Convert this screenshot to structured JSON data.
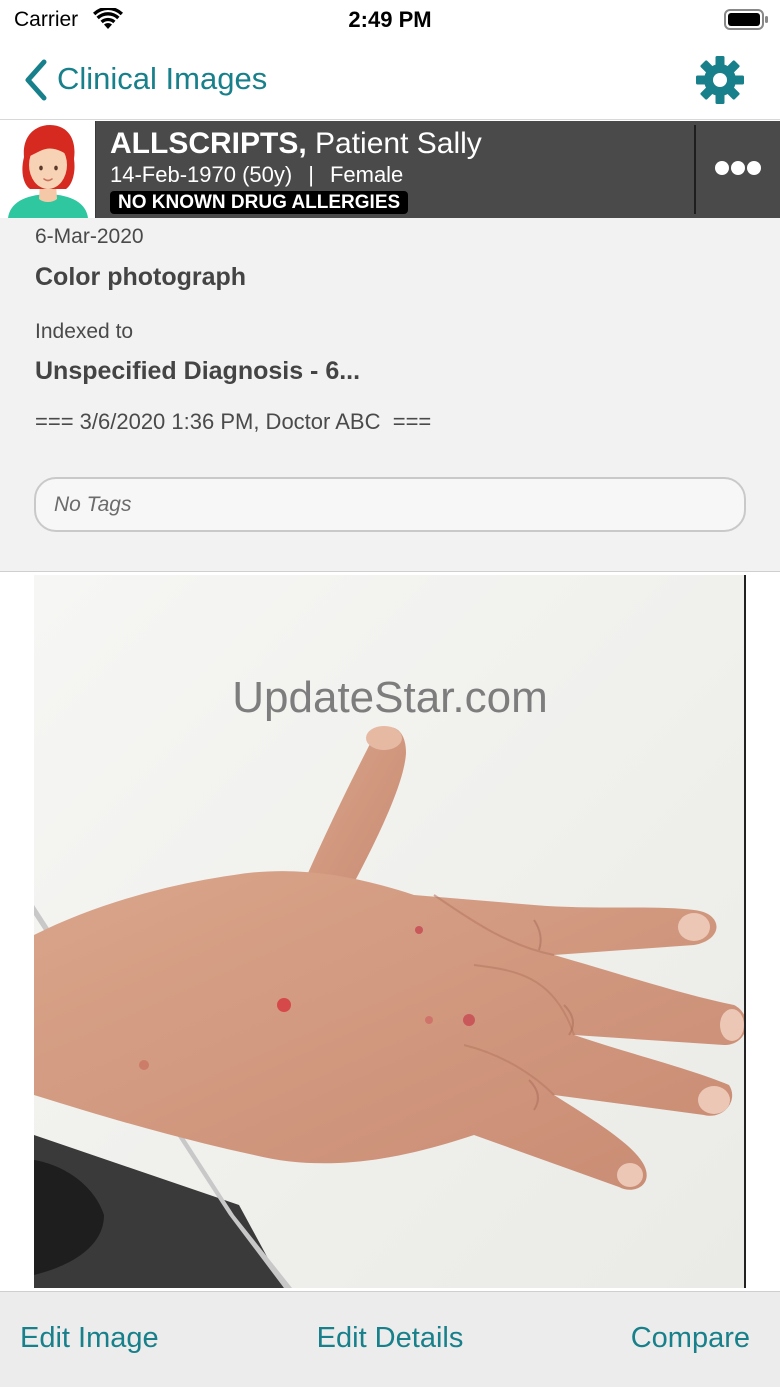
{
  "status_bar": {
    "carrier": "Carrier",
    "time": "2:49 PM"
  },
  "nav": {
    "back_label": "Clinical Images",
    "settings_icon": "gear-icon"
  },
  "patient": {
    "last_name": "ALLSCRIPTS,",
    "first_name": "Patient Sally",
    "dob": "14-Feb-1970 (50y)",
    "separator": "|",
    "gender": "Female",
    "allergy_banner": "NO KNOWN DRUG ALLERGIES"
  },
  "details": {
    "date": "6-Mar-2020",
    "type": "Color photograph",
    "indexed_label": "Indexed to",
    "diagnosis": "Unspecified Diagnosis - 6...",
    "note": "=== 3/6/2020 1:36 PM, Doctor ABC  ===",
    "tags_placeholder": "No Tags"
  },
  "image": {
    "watermark": "UpdateStar.com",
    "subject": "photo of a hand with red spots"
  },
  "toolbar": {
    "edit_image": "Edit Image",
    "edit_details": "Edit Details",
    "compare": "Compare"
  },
  "colors": {
    "accent": "#17808a",
    "banner_bg": "#4a4a4a"
  }
}
